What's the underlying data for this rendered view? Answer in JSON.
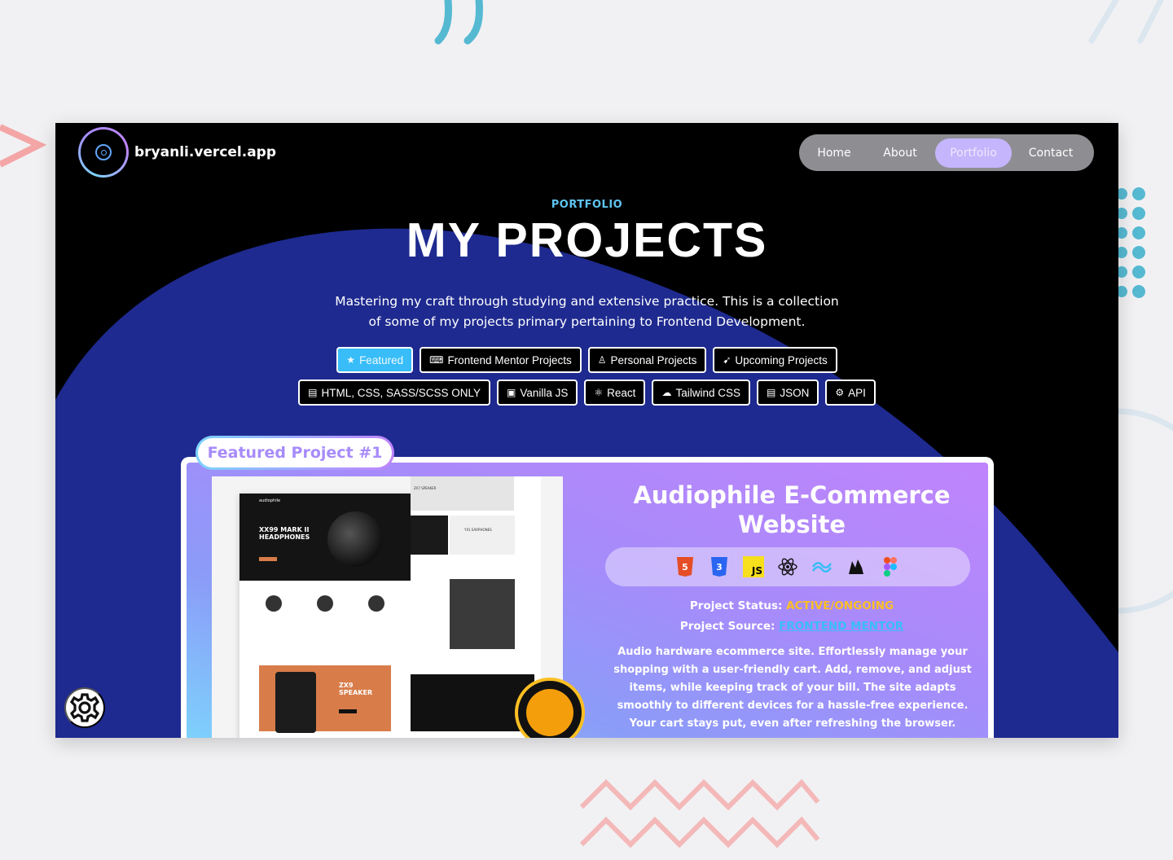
{
  "site": {
    "domain": "bryanli.vercel.app"
  },
  "nav": {
    "items": [
      "Home",
      "About",
      "Portfolio",
      "Contact"
    ],
    "active": "Portfolio"
  },
  "hero": {
    "eyebrow": "PORTFOLIO",
    "title": "MY PROJECTS",
    "description_line1": "Mastering my craft through studying and extensive practice. This is a collection",
    "description_line2": "of some of my projects primary pertaining to Frontend Development."
  },
  "filters_row1": [
    {
      "label": "Featured",
      "icon": "star-icon",
      "glyph": "★",
      "active": true
    },
    {
      "label": "Frontend Mentor Projects",
      "icon": "laptop-icon",
      "glyph": "💻",
      "active": false
    },
    {
      "label": "Personal Projects",
      "icon": "user-icon",
      "glyph": "👤",
      "active": false
    },
    {
      "label": "Upcoming Projects",
      "icon": "rocket-icon",
      "glyph": "🚀",
      "active": false
    }
  ],
  "filters_row2": [
    {
      "label": "HTML, CSS, SASS/SCSS ONLY",
      "icon": "file-code-icon",
      "glyph": "🗎"
    },
    {
      "label": "Vanilla JS",
      "icon": "file-js-icon",
      "glyph": "▣"
    },
    {
      "label": "React",
      "icon": "react-icon",
      "glyph": "⚛"
    },
    {
      "label": "Tailwind CSS",
      "icon": "cloud-icon",
      "glyph": "☁"
    },
    {
      "label": "JSON",
      "icon": "file-icon",
      "glyph": "🗎"
    },
    {
      "label": "API",
      "icon": "gear-icon",
      "glyph": "⚙"
    }
  ],
  "featured": {
    "tag": "Featured Project #1",
    "title_line1": "Audiophile E-Commerce",
    "title_line2": "Website",
    "tech_icons": [
      "html5-icon",
      "css3-icon",
      "javascript-icon",
      "react-icon",
      "tailwind-icon",
      "redux-icon",
      "figma-icon"
    ],
    "status_label": "Project Status:",
    "status_value": "ACTIVE/ONGOING",
    "source_label": "Project Source:",
    "source_value": "FRONTEND MENTOR",
    "description": [
      "Audio hardware ecommerce site. Effortlessly manage your",
      "shopping with a user-friendly cart. Add, remove, and adjust",
      "items, while keeping track of your bill. The site adapts",
      "smoothly to different devices for a hassle-free experience.",
      "Your cart stays put, even after refreshing the browser."
    ],
    "screenshot": {
      "brand": "audiophile",
      "hero_text_1": "XX99 MARK II",
      "hero_text_2": "HEADPHONES",
      "promo_text_1": "ZX9",
      "promo_text_2": "SPEAKER",
      "side_label_1": "ZX7 SPEAKER",
      "side_label_2": "YX1 EARPHONES"
    }
  },
  "colors": {
    "accent": "#38bdf8",
    "purple": "#a78bfa",
    "status": "#fbbf24",
    "blob": "#1e2a8f"
  }
}
